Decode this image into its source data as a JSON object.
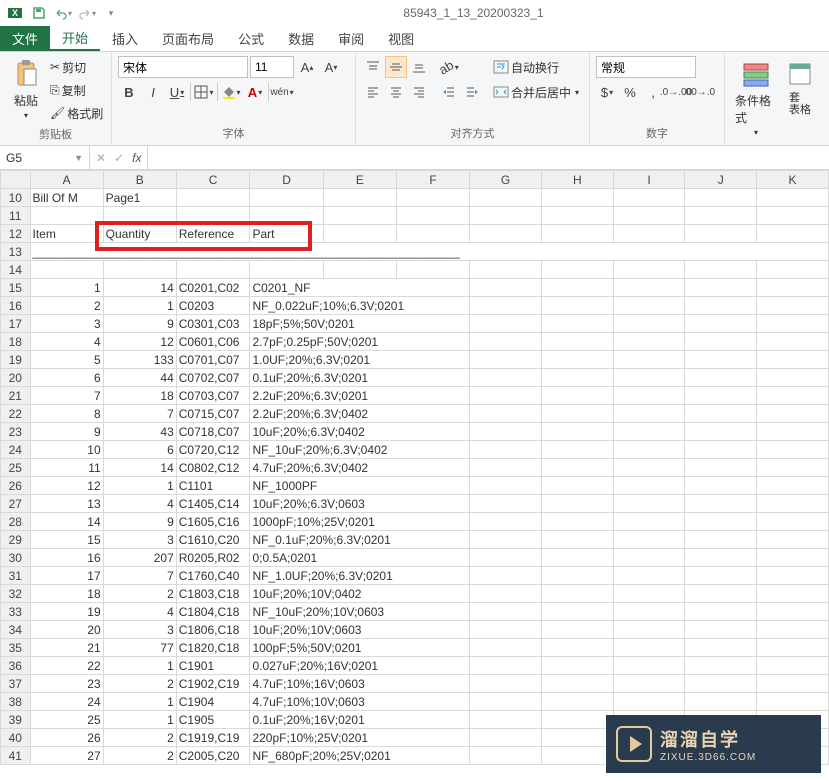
{
  "app": {
    "document_title": "85943_1_13_20200323_1"
  },
  "qat": {
    "save_icon": "save",
    "undo_icon": "undo",
    "redo_icon": "redo"
  },
  "tabs": {
    "file": "文件",
    "items": [
      "开始",
      "插入",
      "页面布局",
      "公式",
      "数据",
      "审阅",
      "视图"
    ],
    "active": "开始"
  },
  "ribbon": {
    "clipboard": {
      "paste": "粘贴",
      "cut": "剪切",
      "copy": "复制",
      "format_painter": "格式刷",
      "group_label": "剪贴板"
    },
    "font": {
      "font_name": "宋体",
      "font_size": "11",
      "bold": "B",
      "italic": "I",
      "underline": "U",
      "pinyin": "wén",
      "group_label": "字体"
    },
    "alignment": {
      "wrap": "自动换行",
      "merge": "合并后居中",
      "group_label": "对齐方式"
    },
    "number": {
      "format": "常规",
      "group_label": "数字"
    },
    "styles": {
      "cond_format": "条件格式",
      "cell_styles": "套\n表格",
      "group_label": ""
    }
  },
  "formula_bar": {
    "name_box": "G5",
    "fx": "fx",
    "value": ""
  },
  "columns": [
    "A",
    "B",
    "C",
    "D",
    "E",
    "F",
    "G",
    "H",
    "I",
    "J",
    "K"
  ],
  "sheet_title_row": {
    "row": 10,
    "a": "Bill Of M",
    "b": "Page1"
  },
  "header_row": {
    "row": 12,
    "a": "Item",
    "b": "Quantity",
    "c": "Reference",
    "d": "Part"
  },
  "dash_row": {
    "row": 13,
    "text": "________________________________________________________________"
  },
  "rows": [
    {
      "r": 15,
      "item": 1,
      "qty": 14,
      "ref": "C0201,C02",
      "part": "C0201_NF"
    },
    {
      "r": 16,
      "item": 2,
      "qty": 1,
      "ref": "C0203",
      "part": "NF_0.022uF;10%;6.3V;0201"
    },
    {
      "r": 17,
      "item": 3,
      "qty": 9,
      "ref": "C0301,C03",
      "part": "18pF;5%;50V;0201"
    },
    {
      "r": 18,
      "item": 4,
      "qty": 12,
      "ref": "C0601,C06",
      "part": "2.7pF;0.25pF;50V;0201"
    },
    {
      "r": 19,
      "item": 5,
      "qty": 133,
      "ref": "C0701,C07",
      "part": "1.0UF;20%;6.3V;0201"
    },
    {
      "r": 20,
      "item": 6,
      "qty": 44,
      "ref": "C0702,C07",
      "part": "0.1uF;20%;6.3V;0201"
    },
    {
      "r": 21,
      "item": 7,
      "qty": 18,
      "ref": "C0703,C07",
      "part": "2.2uF;20%;6.3V;0201"
    },
    {
      "r": 22,
      "item": 8,
      "qty": 7,
      "ref": "C0715,C07",
      "part": "2.2uF;20%;6.3V;0402"
    },
    {
      "r": 23,
      "item": 9,
      "qty": 43,
      "ref": "C0718,C07",
      "part": "10uF;20%;6.3V;0402"
    },
    {
      "r": 24,
      "item": 10,
      "qty": 6,
      "ref": "C0720,C12",
      "part": "NF_10uF;20%;6.3V;0402"
    },
    {
      "r": 25,
      "item": 11,
      "qty": 14,
      "ref": "C0802,C12",
      "part": "4.7uF;20%;6.3V;0402"
    },
    {
      "r": 26,
      "item": 12,
      "qty": 1,
      "ref": "C1101",
      "part": "NF_1000PF"
    },
    {
      "r": 27,
      "item": 13,
      "qty": 4,
      "ref": "C1405,C14",
      "part": "10uF;20%;6.3V;0603"
    },
    {
      "r": 28,
      "item": 14,
      "qty": 9,
      "ref": "C1605,C16",
      "part": "1000pF;10%;25V;0201"
    },
    {
      "r": 29,
      "item": 15,
      "qty": 3,
      "ref": "C1610,C20",
      "part": "NF_0.1uF;20%;6.3V;0201"
    },
    {
      "r": 30,
      "item": 16,
      "qty": 207,
      "ref": "R0205,R02",
      "part": "0;0.5A;0201"
    },
    {
      "r": 31,
      "item": 17,
      "qty": 7,
      "ref": "C1760,C40",
      "part": "NF_1.0UF;20%;6.3V;0201"
    },
    {
      "r": 32,
      "item": 18,
      "qty": 2,
      "ref": "C1803,C18",
      "part": "10uF;20%;10V;0402"
    },
    {
      "r": 33,
      "item": 19,
      "qty": 4,
      "ref": "C1804,C18",
      "part": "NF_10uF;20%;10V;0603"
    },
    {
      "r": 34,
      "item": 20,
      "qty": 3,
      "ref": "C1806,C18",
      "part": "10uF;20%;10V;0603"
    },
    {
      "r": 35,
      "item": 21,
      "qty": 77,
      "ref": "C1820,C18",
      "part": "100pF;5%;50V;0201"
    },
    {
      "r": 36,
      "item": 22,
      "qty": 1,
      "ref": "C1901",
      "part": "0.027uF;20%;16V;0201"
    },
    {
      "r": 37,
      "item": 23,
      "qty": 2,
      "ref": "C1902,C19",
      "part": "4.7uF;10%;16V;0603"
    },
    {
      "r": 38,
      "item": 24,
      "qty": 1,
      "ref": "C1904",
      "part": "4.7uF;10%;10V;0603"
    },
    {
      "r": 39,
      "item": 25,
      "qty": 1,
      "ref": "C1905",
      "part": "0.1uF;20%;16V;0201"
    },
    {
      "r": 40,
      "item": 26,
      "qty": 2,
      "ref": "C1919,C19",
      "part": "220pF;10%;25V;0201"
    },
    {
      "r": 41,
      "item": 27,
      "qty": 2,
      "ref": "C2005,C20",
      "part": "NF_680pF;20%;25V;0201"
    }
  ],
  "watermark": {
    "brand": "溜溜自学",
    "url": "ZIXUE.3D66.COM"
  }
}
